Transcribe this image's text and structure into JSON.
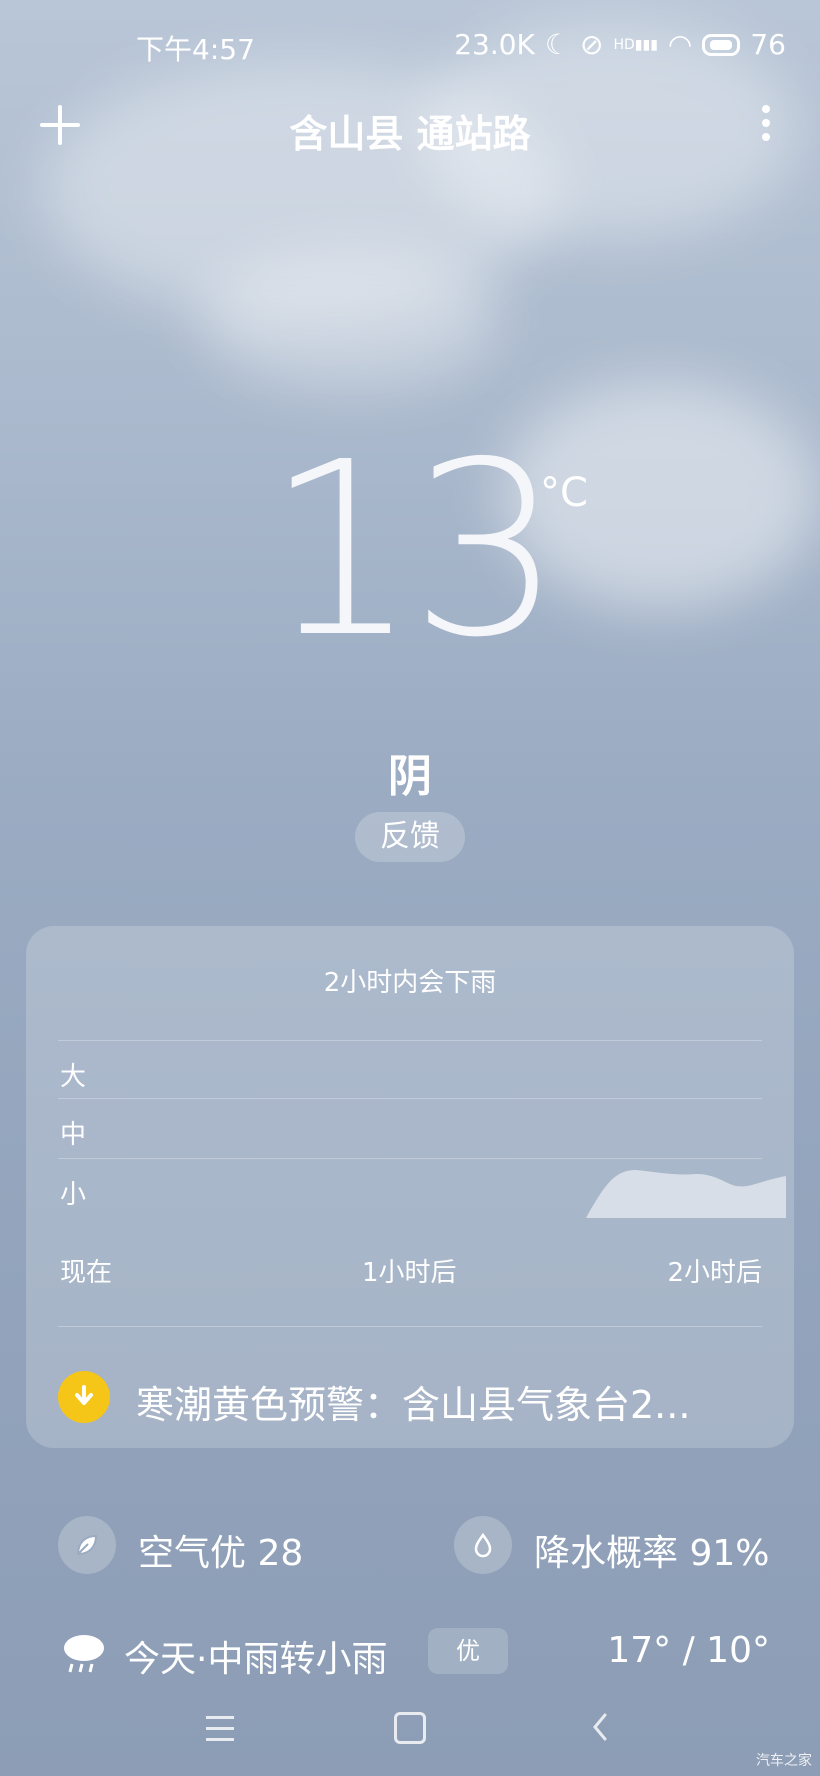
{
  "status_bar": {
    "time": "下午4:57",
    "net_speed": "23.0K",
    "network": "HD",
    "battery": "76"
  },
  "header": {
    "location": "含山县 通站路"
  },
  "current": {
    "temperature": "13",
    "unit": "°C",
    "condition": "阴",
    "feedback_label": "反馈"
  },
  "rain_card": {
    "title": "2小时内会下雨",
    "levels": [
      "大",
      "中",
      "小"
    ],
    "time_labels": [
      "现在",
      "1小时后",
      "2小时后"
    ],
    "warning_text": "寒潮黄色预警：含山县气象台2..."
  },
  "air": {
    "label": "空气优 28"
  },
  "precip": {
    "label": "降水概率 91%"
  },
  "today": {
    "label": "今天·中雨转小雨",
    "aqi_badge": "优",
    "temps": "17° / 10°"
  },
  "watermark": "汽车之家",
  "colors": {
    "warning": "#f5c518"
  }
}
